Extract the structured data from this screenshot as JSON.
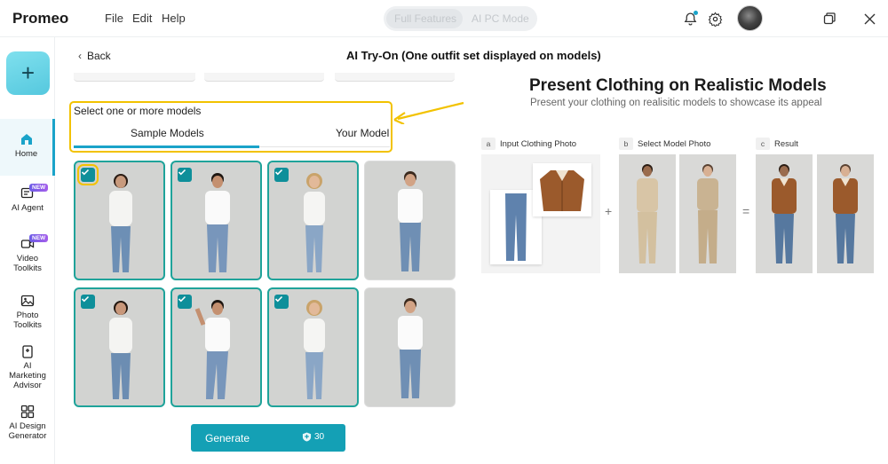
{
  "app": {
    "brand": "Promeo"
  },
  "menu": {
    "file": "File",
    "edit": "Edit",
    "help": "Help"
  },
  "mode": {
    "full": "Full Features",
    "pc": "AI PC Mode"
  },
  "sidebar": {
    "items": [
      {
        "label": "Home",
        "icon": "home-icon"
      },
      {
        "label": "AI Agent",
        "icon": "ai-agent-icon",
        "badge": "NEW"
      },
      {
        "label": "Video Toolkits",
        "icon": "video-icon",
        "badge": "NEW"
      },
      {
        "label": "Photo Toolkits",
        "icon": "photo-icon"
      },
      {
        "label": "AI Marketing Advisor",
        "icon": "marketing-icon"
      },
      {
        "label": "AI Design Generator",
        "icon": "design-grid-icon"
      }
    ]
  },
  "nav": {
    "back": "Back"
  },
  "page": {
    "title": "AI Try-On (One outfit set displayed on models)"
  },
  "models": {
    "prompt": "Select one or more models",
    "tab_sample": "Sample Models",
    "tab_yours": "Your Model",
    "tiles": [
      {
        "name": "model-tile-woman-1",
        "checked": true
      },
      {
        "name": "model-tile-man-1",
        "checked": true
      },
      {
        "name": "model-tile-woman-2",
        "checked": true
      },
      {
        "name": "model-tile-man-2",
        "checked": false
      },
      {
        "name": "model-tile-woman-3",
        "checked": true
      },
      {
        "name": "model-tile-man-3",
        "checked": true
      },
      {
        "name": "model-tile-woman-4",
        "checked": true
      },
      {
        "name": "model-tile-man-4",
        "checked": false
      }
    ]
  },
  "generate": {
    "label": "Generate",
    "cost": "30"
  },
  "example": {
    "title": "Present Clothing on Realistic Models",
    "subtitle": "Present your clothing on realisitic models to showcase its appeal",
    "step_a_letter": "a",
    "step_a": "Input Clothing Photo",
    "step_b_letter": "b",
    "step_b": "Select Model Photo",
    "step_c_letter": "c",
    "step_c": "Result",
    "plus": "+",
    "equals": "="
  },
  "colors": {
    "accent": "#1aa3c9",
    "highlight": "#f2c200",
    "check": "#0e8f9a",
    "generate": "#14a0b5"
  }
}
